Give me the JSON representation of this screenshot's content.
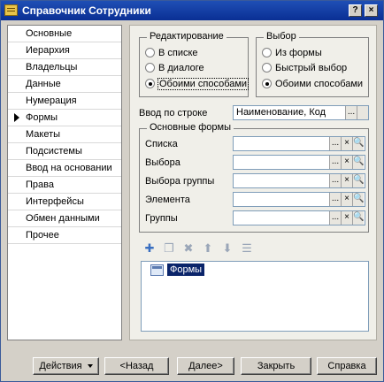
{
  "window": {
    "title": "Справочник Сотрудники",
    "help_glyph": "?",
    "close_glyph": "×"
  },
  "sidebar": {
    "items": [
      {
        "label": "Основные",
        "name": "sidebar-item-osnovnye"
      },
      {
        "label": "Иерархия",
        "name": "sidebar-item-ierarkhiya"
      },
      {
        "label": "Владельцы",
        "name": "sidebar-item-vladeltsy"
      },
      {
        "label": "Данные",
        "name": "sidebar-item-dannye"
      },
      {
        "label": "Нумерация",
        "name": "sidebar-item-numeratsiya"
      },
      {
        "label": "Формы",
        "name": "sidebar-item-formy",
        "active": true
      },
      {
        "label": "Макеты",
        "name": "sidebar-item-makety"
      },
      {
        "label": "Подсистемы",
        "name": "sidebar-item-podsistemy"
      },
      {
        "label": "Ввод на основании",
        "name": "sidebar-item-vvod-na-osnovanii"
      },
      {
        "label": "Права",
        "name": "sidebar-item-prava"
      },
      {
        "label": "Интерфейсы",
        "name": "sidebar-item-interfeysy"
      },
      {
        "label": "Обмен данными",
        "name": "sidebar-item-obmen-dannymi"
      },
      {
        "label": "Прочее",
        "name": "sidebar-item-prochee"
      }
    ]
  },
  "editing": {
    "legend": "Редактирование",
    "options": [
      "В списке",
      "В диалоге",
      "Обоими способами"
    ],
    "selected_index": 2
  },
  "choice": {
    "legend": "Выбор",
    "options": [
      "Из формы",
      "Быстрый выбор",
      "Обоими способами"
    ],
    "selected_index": 2
  },
  "input_by_string": {
    "label": "Ввод по строке",
    "value": "Наименование, Код",
    "button": "..."
  },
  "main_forms": {
    "legend": "Основные формы",
    "fields": [
      {
        "label": "Списка",
        "value": ""
      },
      {
        "label": "Выбора",
        "value": ""
      },
      {
        "label": "Выбора группы",
        "value": ""
      },
      {
        "label": "Элемента",
        "value": ""
      },
      {
        "label": "Группы",
        "value": ""
      }
    ],
    "btn_select": "...",
    "btn_clear": "×",
    "btn_open": "🔍"
  },
  "tree_toolbar": {
    "icons": [
      "add-form-icon",
      "copy-icon",
      "delete-icon",
      "move-up-icon",
      "move-down-icon",
      "sort-icon"
    ]
  },
  "tree": {
    "root_label": "Формы"
  },
  "buttons": {
    "actions": "Действия",
    "back": "<Назад",
    "next": "Далее>",
    "close": "Закрыть",
    "help": "Справка"
  }
}
